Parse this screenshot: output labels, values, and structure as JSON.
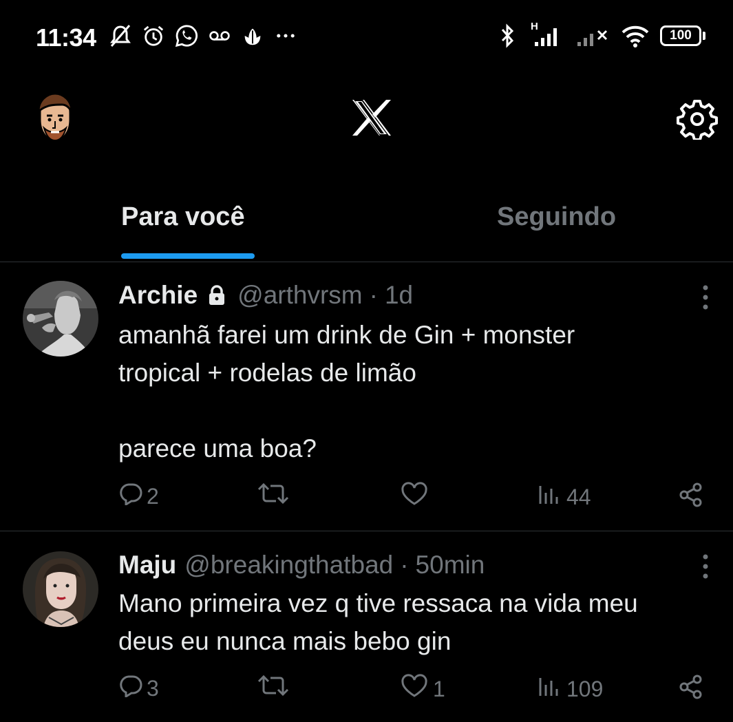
{
  "status_bar": {
    "time": "11:34",
    "battery": "100",
    "signal_label": "H",
    "icons_left": [
      "alarm-off-icon",
      "alarm-clock-icon",
      "whatsapp-icon",
      "voicemail-icon",
      "tulip-icon",
      "more-notifications-icon"
    ],
    "icons_right": [
      "bluetooth-icon",
      "signal-icon",
      "signal-no-service-icon",
      "wifi-icon",
      "battery-icon"
    ]
  },
  "header": {
    "logo": "x-logo-icon",
    "settings_icon": "gear-icon"
  },
  "tabs": [
    {
      "label": "Para você",
      "active": true
    },
    {
      "label": "Seguindo",
      "active": false
    }
  ],
  "tweets": [
    {
      "name": "Archie",
      "protected": true,
      "handle": "@arthvrsm",
      "sep": "·",
      "ago": "1d",
      "text": "amanhã farei um drink de Gin + monster\ntropical + rodelas de limão\n\nparece uma boa?",
      "replies": "2",
      "retweets": "",
      "likes": "",
      "views": "44"
    },
    {
      "name": "Maju",
      "protected": false,
      "handle": "@breakingthatbad",
      "sep": "·",
      "ago": "50min",
      "text": "Mano primeira vez q tive ressaca na vida meu\ndeus eu nunca mais bebo gin",
      "replies": "3",
      "retweets": "",
      "likes": "1",
      "views": "109"
    }
  ],
  "colors": {
    "background": "#000000",
    "text": "#e7e9ea",
    "secondary": "#71767b",
    "accent": "#1d9bf0",
    "divider": "#2f3336"
  }
}
